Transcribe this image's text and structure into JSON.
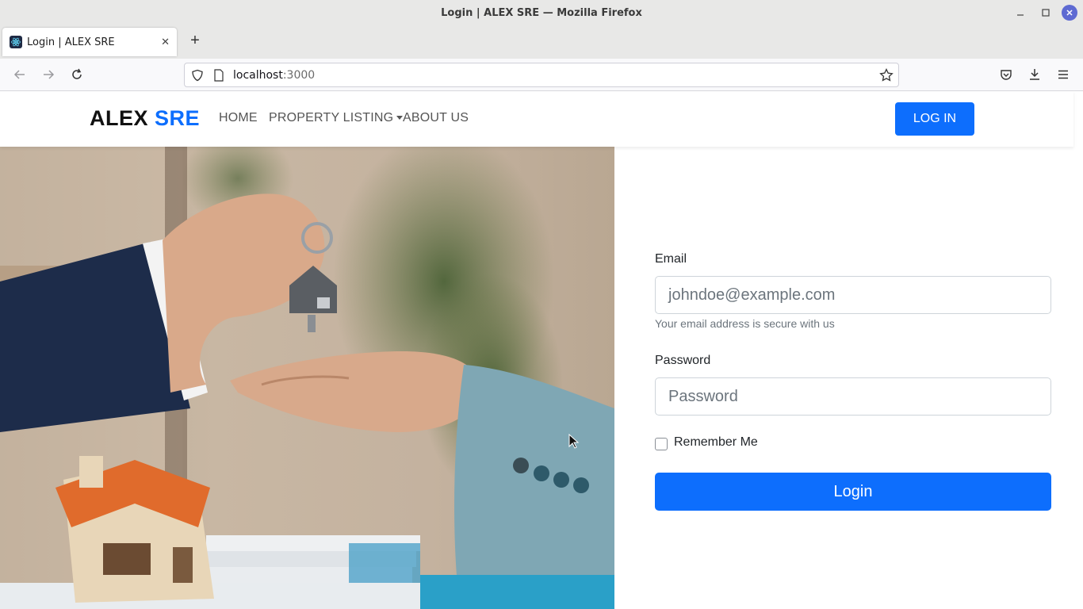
{
  "window": {
    "title": "Login | ALEX SRE — Mozilla Firefox"
  },
  "browser": {
    "tab_label": "Login | ALEX SRE",
    "url_host": "localhost",
    "url_port": ":3000"
  },
  "site": {
    "brand_main": "ALEX",
    "brand_accent": "SRE",
    "nav": {
      "home": "HOME",
      "property_listing": "PROPERTY LISTING",
      "about_us": "ABOUT US"
    },
    "login_button": "LOG IN"
  },
  "form": {
    "email_label": "Email",
    "email_placeholder": "johndoe@example.com",
    "email_help": "Your email address is secure with us",
    "password_label": "Password",
    "password_placeholder": "Password",
    "remember_label": "Remember Me",
    "submit_label": "Login"
  },
  "colors": {
    "accent": "#0d6efd",
    "brand_text": "#111111",
    "nav_text": "#555555"
  }
}
